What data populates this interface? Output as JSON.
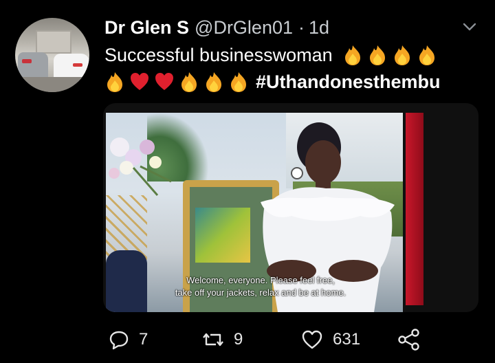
{
  "tweet": {
    "display_name": "Dr Glen S",
    "handle": "@DrGlen01",
    "separator": "·",
    "time": "1d",
    "text": "Successful businesswoman",
    "hashtag": "#Uthandonesthembu"
  },
  "media": {
    "subtitle_line1": "Welcome, everyone. Please feel free,",
    "subtitle_line2": "take off your jackets, relax and be at home."
  },
  "actions": {
    "replies": "7",
    "retweets": "9",
    "likes": "631"
  },
  "icons": {
    "fire": "fire-icon",
    "heart_emoji": "red-heart-icon",
    "reply": "reply-icon",
    "retweet": "retweet-icon",
    "like": "like-icon",
    "share": "share-icon",
    "menu": "chevron-down-icon"
  },
  "colors": {
    "background": "#000000",
    "text": "#ffffff",
    "secondary_text": "#c9cdd1",
    "fire_orange": "#f5a623",
    "heart_red": "#e0202e"
  }
}
